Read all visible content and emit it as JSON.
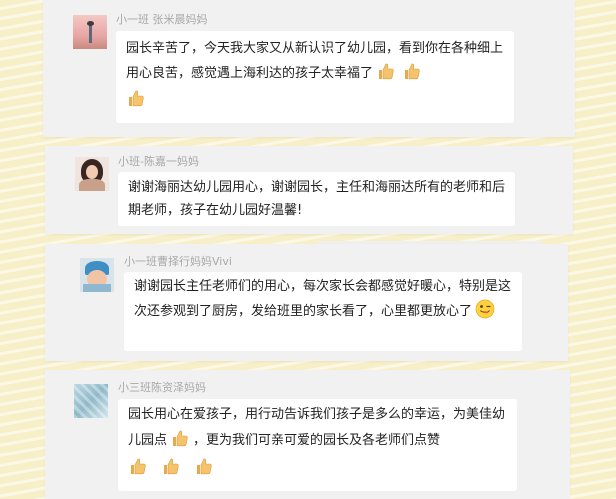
{
  "comments": [
    {
      "name": "小一班   张米晨妈妈",
      "text": "园长辛苦了，今天我大家又从新认识了幼儿园，看到你在各种细上用心良苦，感觉遇上海利达的孩子太幸福了"
    },
    {
      "name": "小班-陈嘉一妈妈",
      "text": "谢谢海丽达幼儿园用心，谢谢园长，主任和海丽达所有的老师和后期老师，孩子在幼儿园好温馨!"
    },
    {
      "name": "小一班曹择行妈妈Vivi",
      "text": "谢谢园长主任老师们的用心，每次家长会都感觉好暖心，特别是这次还参观到了厨房，发给班里的家长看了，心里都更放心了"
    },
    {
      "name": "小三班陈资泽妈妈",
      "text": "园长用心在爱孩子，用行动告诉我们孩子是多么的幸运，为美佳幼儿园点",
      "text2": "，更为我们可亲可爱的园长及各老师们点赞"
    }
  ],
  "icons": {
    "thumbs_up": "thumbs-up-emoji",
    "wink": "wink-tongue-emoji"
  },
  "colors": {
    "background": "#f7efc8",
    "card": "#f1f1f1",
    "bubble": "#ffffff",
    "name_text": "#a8a8a8",
    "thumb": "#f5c36b"
  }
}
